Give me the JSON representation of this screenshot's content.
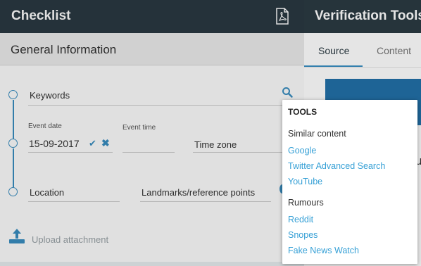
{
  "left_panel": {
    "title": "Checklist",
    "section_title": "General Information",
    "fields": {
      "keywords_placeholder": "Keywords",
      "event_date_label": "Event date",
      "event_date_value": "15-09-2017",
      "event_time_label": "Event time",
      "time_zone_placeholder": "Time zone",
      "location_placeholder": "Location",
      "landmarks_placeholder": "Landmarks/reference points"
    },
    "upload_label": "Upload attachment"
  },
  "right_panel": {
    "title": "Verification Tools",
    "tabs": [
      {
        "label": "Source"
      },
      {
        "label": "Content"
      }
    ],
    "text_fragment": "u"
  },
  "tools_popup": {
    "heading": "TOOLS",
    "groups": [
      {
        "title": "Similar content",
        "links": [
          "Google",
          "Twitter Advanced Search",
          "YouTube"
        ]
      },
      {
        "title": "Rumours",
        "links": [
          "Reddit",
          "Snopes",
          "Fake News Watch"
        ]
      }
    ]
  },
  "colors": {
    "header_bg": "#2b3a42",
    "accent": "#3a8fc2",
    "link": "#36a0d6"
  },
  "icons": [
    "pdf-icon",
    "search-icon",
    "check-icon",
    "close-icon",
    "upload-icon"
  ]
}
